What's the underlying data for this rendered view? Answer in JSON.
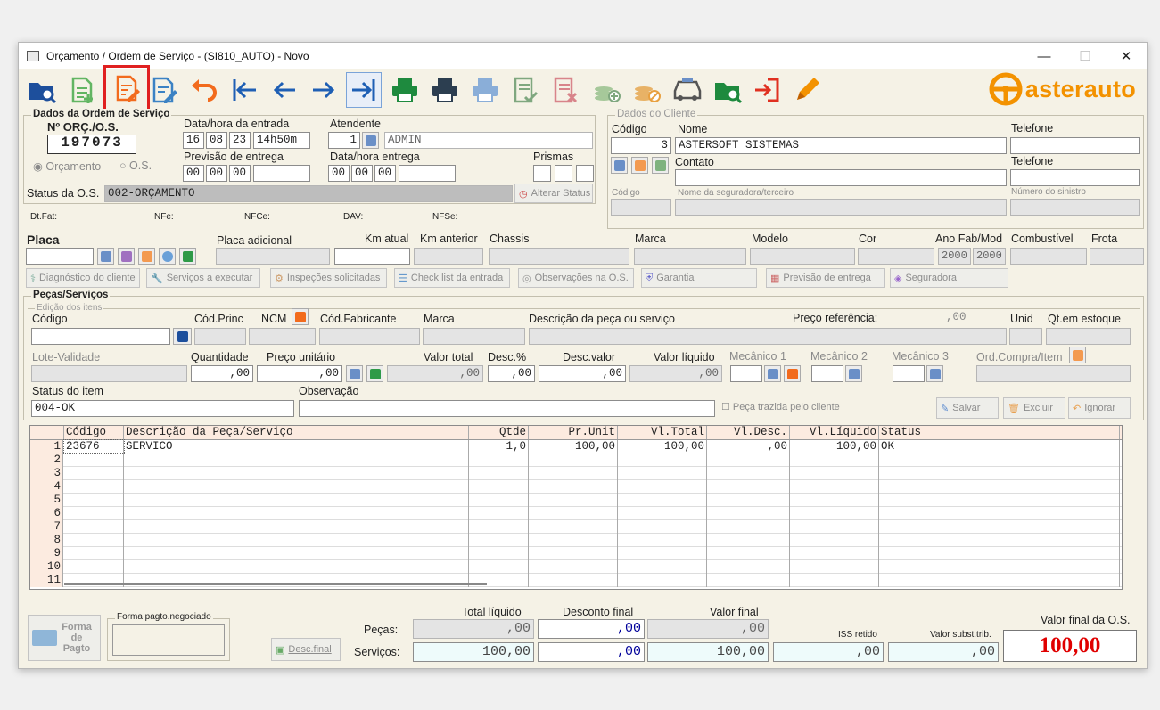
{
  "window": {
    "title": "Orçamento / Ordem de Serviço - (SI810_AUTO) - Novo",
    "minimize": "—",
    "maximize": "☐",
    "close": "✕"
  },
  "logo": {
    "text": "asterauto"
  },
  "order": {
    "section": "Dados da Ordem de Serviço",
    "number_label": "Nº ORÇ./O.S.",
    "number": "197073",
    "entry_label": "Data/hora da entrada",
    "entry_day": "16",
    "entry_month": "08",
    "entry_year": "23",
    "entry_time": "14h50m",
    "attendant_label": "Atendente",
    "attendant_code": "1",
    "attendant_name": "ADMIN",
    "type_orc": "Orçamento",
    "type_os": "O.S.",
    "forecast_label": "Previsão de entrega",
    "delivery_label": "Data/hora entrega",
    "prisms_label": "Prismas",
    "status_label": "Status da O.S.",
    "status_value": "002-ORÇAMENTO",
    "change_status": "Alterar Status",
    "dtfat": "Dt.Fat:",
    "nfe": "NFe:",
    "nfce": "NFCe:",
    "dav": "DAV:",
    "nfse": "NFSe:"
  },
  "client": {
    "section": "Dados do Cliente",
    "code_label": "Código",
    "code": "3",
    "name_label": "Nome",
    "name": "ASTERSOFT SISTEMAS",
    "phone_label": "Telefone",
    "contact_label": "Contato",
    "phone2_label": "Telefone",
    "ins_code_label": "Código",
    "insurer_label": "Nome da seguradora/terceiro",
    "claim_label": "Número do sinistro"
  },
  "vehicle": {
    "plate": "Placa",
    "plate_add": "Placa adicional",
    "km": "Km atual",
    "km_prev": "Km anterior",
    "chassis": "Chassis",
    "brand": "Marca",
    "model": "Modelo",
    "color": "Cor",
    "year_label": "Ano Fab/Mod",
    "year_fab": "2000",
    "year_mod": "2000",
    "fuel": "Combustível",
    "fleet": "Frota"
  },
  "actions": [
    "Diagnóstico do cliente",
    "Serviços a executar",
    "Inspeções solicitadas",
    "Check list da entrada",
    "Observações na O.S.",
    "Garantia",
    "Previsão de entrega",
    "Seguradora"
  ],
  "parts": {
    "section": "Peças/Serviços",
    "edit_section": "Edição dos itens",
    "code": "Código",
    "code_princ": "Cód.Princ",
    "ncm": "NCM",
    "code_fab": "Cód.Fabricante",
    "brand": "Marca",
    "desc": "Descrição da peça ou serviço",
    "ref_price": "Preço referência:",
    "ref_price_value": ",00",
    "unit": "Unid",
    "stock": "Qt.em estoque",
    "lot": "Lote-Validade",
    "qty": "Quantidade",
    "qty_value": ",00",
    "unit_price": "Preço unitário",
    "unit_price_value": ",00",
    "total": "Valor total",
    "total_value": ",00",
    "disc_pct": "Desc.%",
    "disc_pct_value": ",00",
    "disc_val": "Desc.valor",
    "disc_val_value": ",00",
    "net": "Valor líquido",
    "net_value": ",00",
    "mec1": "Mecânico 1",
    "mec2": "Mecânico 2",
    "mec3": "Mecânico 3",
    "po": "Ord.Compra/Item",
    "item_status": "Status do item",
    "item_status_value": "004-OK",
    "obs": "Observação",
    "client_part": "Peça trazida pelo cliente",
    "save": "Salvar",
    "delete": "Excluir",
    "ignore": "Ignorar"
  },
  "grid": {
    "headers": [
      "Código",
      "Descrição da Peça/Serviço",
      "Qtde",
      "Pr.Unit",
      "Vl.Total",
      "Vl.Desc.",
      "Vl.Líquido",
      "Status"
    ],
    "row_numbers": [
      "1",
      "2",
      "3",
      "4",
      "5",
      "6",
      "7",
      "8",
      "9",
      "10",
      "11"
    ],
    "rows": [
      [
        "23676",
        "SERVICO",
        "1,0",
        "100,00",
        "100,00",
        ",00",
        "100,00",
        "OK"
      ]
    ]
  },
  "totals": {
    "payment_btn": "Forma de Pagto",
    "payment_neg": "Forma pagto.negociado",
    "final_disc_btn": "Desc.final",
    "net_label": "Total líquido",
    "disc_label": "Desconto final",
    "final_label": "Valor final",
    "parts_label": "Peças:",
    "services_label": "Serviços:",
    "parts_net": ",00",
    "parts_disc": ",00",
    "parts_final": ",00",
    "services_net": "100,00",
    "services_disc": ",00",
    "services_final": "100,00",
    "iss_label": "ISS retido",
    "iss": ",00",
    "subst_label": "Valor subst.trib.",
    "subst": ",00",
    "os_final_label": "Valor final da O.S.",
    "os_final": "100,00"
  },
  "colors": {
    "accent": "#f39200",
    "total_red": "#e00000",
    "highlight": "#e02020"
  }
}
